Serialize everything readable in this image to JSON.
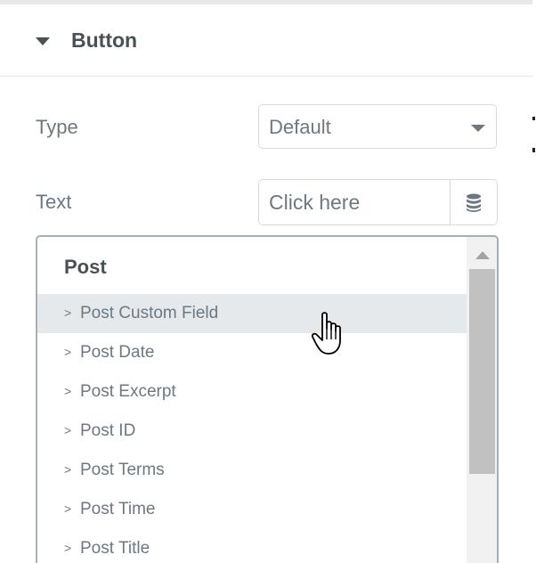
{
  "section": {
    "title": "Button",
    "collapse_icon": "caret-down-icon"
  },
  "controls": {
    "type": {
      "label": "Type",
      "value": "Default",
      "icon": "chevron-down-icon"
    },
    "text": {
      "label": "Text",
      "value": "Click here",
      "dynamic_icon": "database-icon"
    }
  },
  "dropdown": {
    "group_title": "Post",
    "options": [
      {
        "arrow": ">",
        "label": "Post Custom Field",
        "hovered": true
      },
      {
        "arrow": ">",
        "label": "Post Date"
      },
      {
        "arrow": ">",
        "label": "Post Excerpt"
      },
      {
        "arrow": ">",
        "label": "Post ID"
      },
      {
        "arrow": ">",
        "label": "Post Terms"
      },
      {
        "arrow": ">",
        "label": "Post Time"
      },
      {
        "arrow": ">",
        "label": "Post Title"
      }
    ]
  },
  "colors": {
    "heading": "#495157",
    "text": "#6d7882",
    "border": "#d5dadf",
    "dropdown_border": "#a4afb7",
    "hover_bg": "#e6e9ec",
    "scroll_thumb": "#c1c1c1"
  }
}
